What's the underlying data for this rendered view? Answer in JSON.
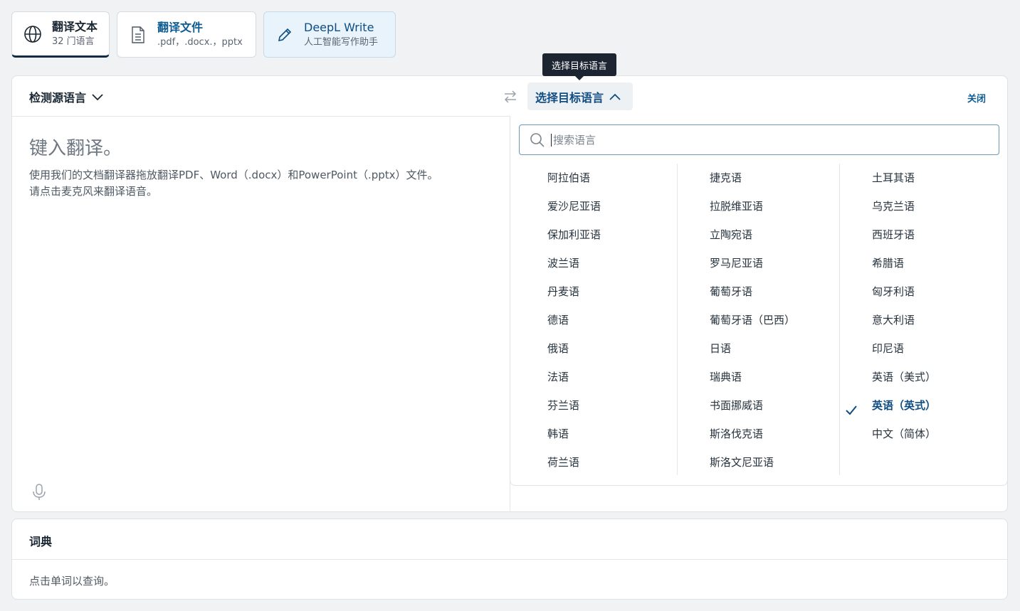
{
  "tabs": [
    {
      "title": "翻译文本",
      "subtitle": "32 门语言",
      "icon": "globe-icon"
    },
    {
      "title": "翻译文件",
      "subtitle": ".pdf，.docx.，pptx",
      "icon": "document-icon"
    },
    {
      "title": "DeepL Write",
      "subtitle": "人工智能写作助手",
      "icon": "pencil-icon"
    }
  ],
  "tooltip": "选择目标语言",
  "header": {
    "source_lang": "检测源语言",
    "target_lang": "选择目标语言",
    "close": "关闭"
  },
  "source": {
    "placeholder": "键入翻译。",
    "hint_line1": "使用我们的文档翻译器拖放翻译PDF、Word（.docx）和PowerPoint（.pptx）文件。",
    "hint_line2": "请点击麦克风来翻译语音。"
  },
  "dropdown": {
    "search_placeholder": "搜索语言",
    "columns": [
      [
        "阿拉伯语",
        "爱沙尼亚语",
        "保加利亚语",
        "波兰语",
        "丹麦语",
        "德语",
        "俄语",
        "法语",
        "芬兰语",
        "韩语",
        "荷兰语"
      ],
      [
        "捷克语",
        "拉脱维亚语",
        "立陶宛语",
        "罗马尼亚语",
        "葡萄牙语",
        "葡萄牙语（巴西）",
        "日语",
        "瑞典语",
        "书面挪威语",
        "斯洛伐克语",
        "斯洛文尼亚语"
      ],
      [
        "土耳其语",
        "乌克兰语",
        "西班牙语",
        "希腊语",
        "匈牙利语",
        "意大利语",
        "印尼语",
        "英语（美式）",
        "英语（英式）",
        "中文（简体）"
      ]
    ],
    "selected": "英语（英式）"
  },
  "dictionary": {
    "title": "词典",
    "hint": "点击单词以查询。"
  },
  "colors": {
    "accent": "#0f4c81",
    "tooltip_bg": "#1c2531",
    "page_bg": "#f1f2f4"
  }
}
